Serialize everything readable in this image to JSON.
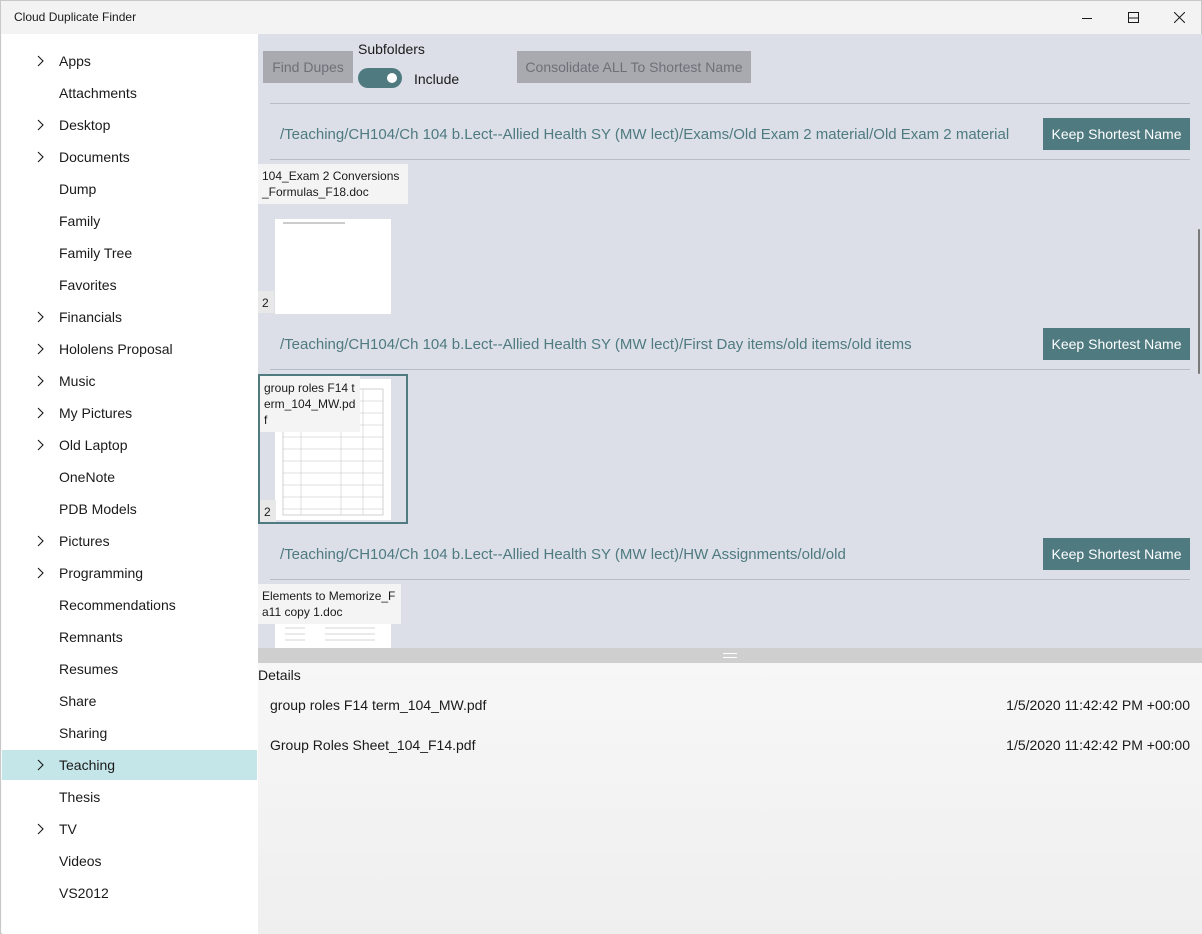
{
  "app": {
    "title": "Cloud Duplicate Finder"
  },
  "sidebar": {
    "items": [
      {
        "label": "Apps",
        "expandable": true
      },
      {
        "label": "Attachments",
        "expandable": false
      },
      {
        "label": "Desktop",
        "expandable": true
      },
      {
        "label": "Documents",
        "expandable": true
      },
      {
        "label": "Dump",
        "expandable": false
      },
      {
        "label": "Family",
        "expandable": false
      },
      {
        "label": "Family Tree",
        "expandable": false
      },
      {
        "label": "Favorites",
        "expandable": false
      },
      {
        "label": "Financials",
        "expandable": true
      },
      {
        "label": "Hololens Proposal",
        "expandable": true
      },
      {
        "label": "Music",
        "expandable": true
      },
      {
        "label": "My Pictures",
        "expandable": true
      },
      {
        "label": "Old Laptop",
        "expandable": true
      },
      {
        "label": "OneNote",
        "expandable": false
      },
      {
        "label": "PDB Models",
        "expandable": false
      },
      {
        "label": "Pictures",
        "expandable": true
      },
      {
        "label": "Programming",
        "expandable": true
      },
      {
        "label": "Recommendations",
        "expandable": false
      },
      {
        "label": "Remnants",
        "expandable": false
      },
      {
        "label": "Resumes",
        "expandable": false
      },
      {
        "label": "Share",
        "expandable": false
      },
      {
        "label": "Sharing",
        "expandable": false
      },
      {
        "label": "Teaching",
        "expandable": true,
        "selected": true
      },
      {
        "label": "Thesis",
        "expandable": false
      },
      {
        "label": "TV",
        "expandable": true
      },
      {
        "label": "Videos",
        "expandable": false
      },
      {
        "label": "VS2012",
        "expandable": false
      }
    ]
  },
  "toolbar": {
    "find_dupes": "Find Dupes",
    "subfolders_label": "Subfolders",
    "include_label": "Include",
    "include_on": true,
    "consolidate": "Consolidate ALL To Shortest Name"
  },
  "groups": [
    {
      "path": "/Teaching/CH104/Ch 104 b.Lect--Allied Health SY (MW lect)/Exams/Old Exam 2 material/Old Exam 2 material",
      "button": "Keep Shortest Name",
      "file_label": "104_Exam 2 Conversions_Formulas_F18.doc",
      "count": "2"
    },
    {
      "path": "/Teaching/CH104/Ch 104 b.Lect--Allied Health SY (MW lect)/First Day items/old items/old items",
      "button": "Keep Shortest Name",
      "file_label": "group roles F14 term_104_MW.pdf",
      "count": "2"
    },
    {
      "path": "/Teaching/CH104/Ch 104 b.Lect--Allied Health SY (MW lect)/HW Assignments/old/old",
      "button": "Keep Shortest Name",
      "file_label": "Elements to Memorize_Fa11 copy 1.doc",
      "count": ""
    }
  ],
  "details": {
    "title": "Details",
    "rows": [
      {
        "name": "group roles F14 term_104_MW.pdf",
        "date": "1/5/2020 11:42:42 PM +00:00"
      },
      {
        "name": "Group Roles Sheet_104_F14.pdf",
        "date": "1/5/2020 11:42:42 PM +00:00"
      }
    ]
  },
  "colors": {
    "accent": "#4e7a80",
    "selection": "#c5e6e9",
    "main_bg": "#dcdfe8"
  }
}
